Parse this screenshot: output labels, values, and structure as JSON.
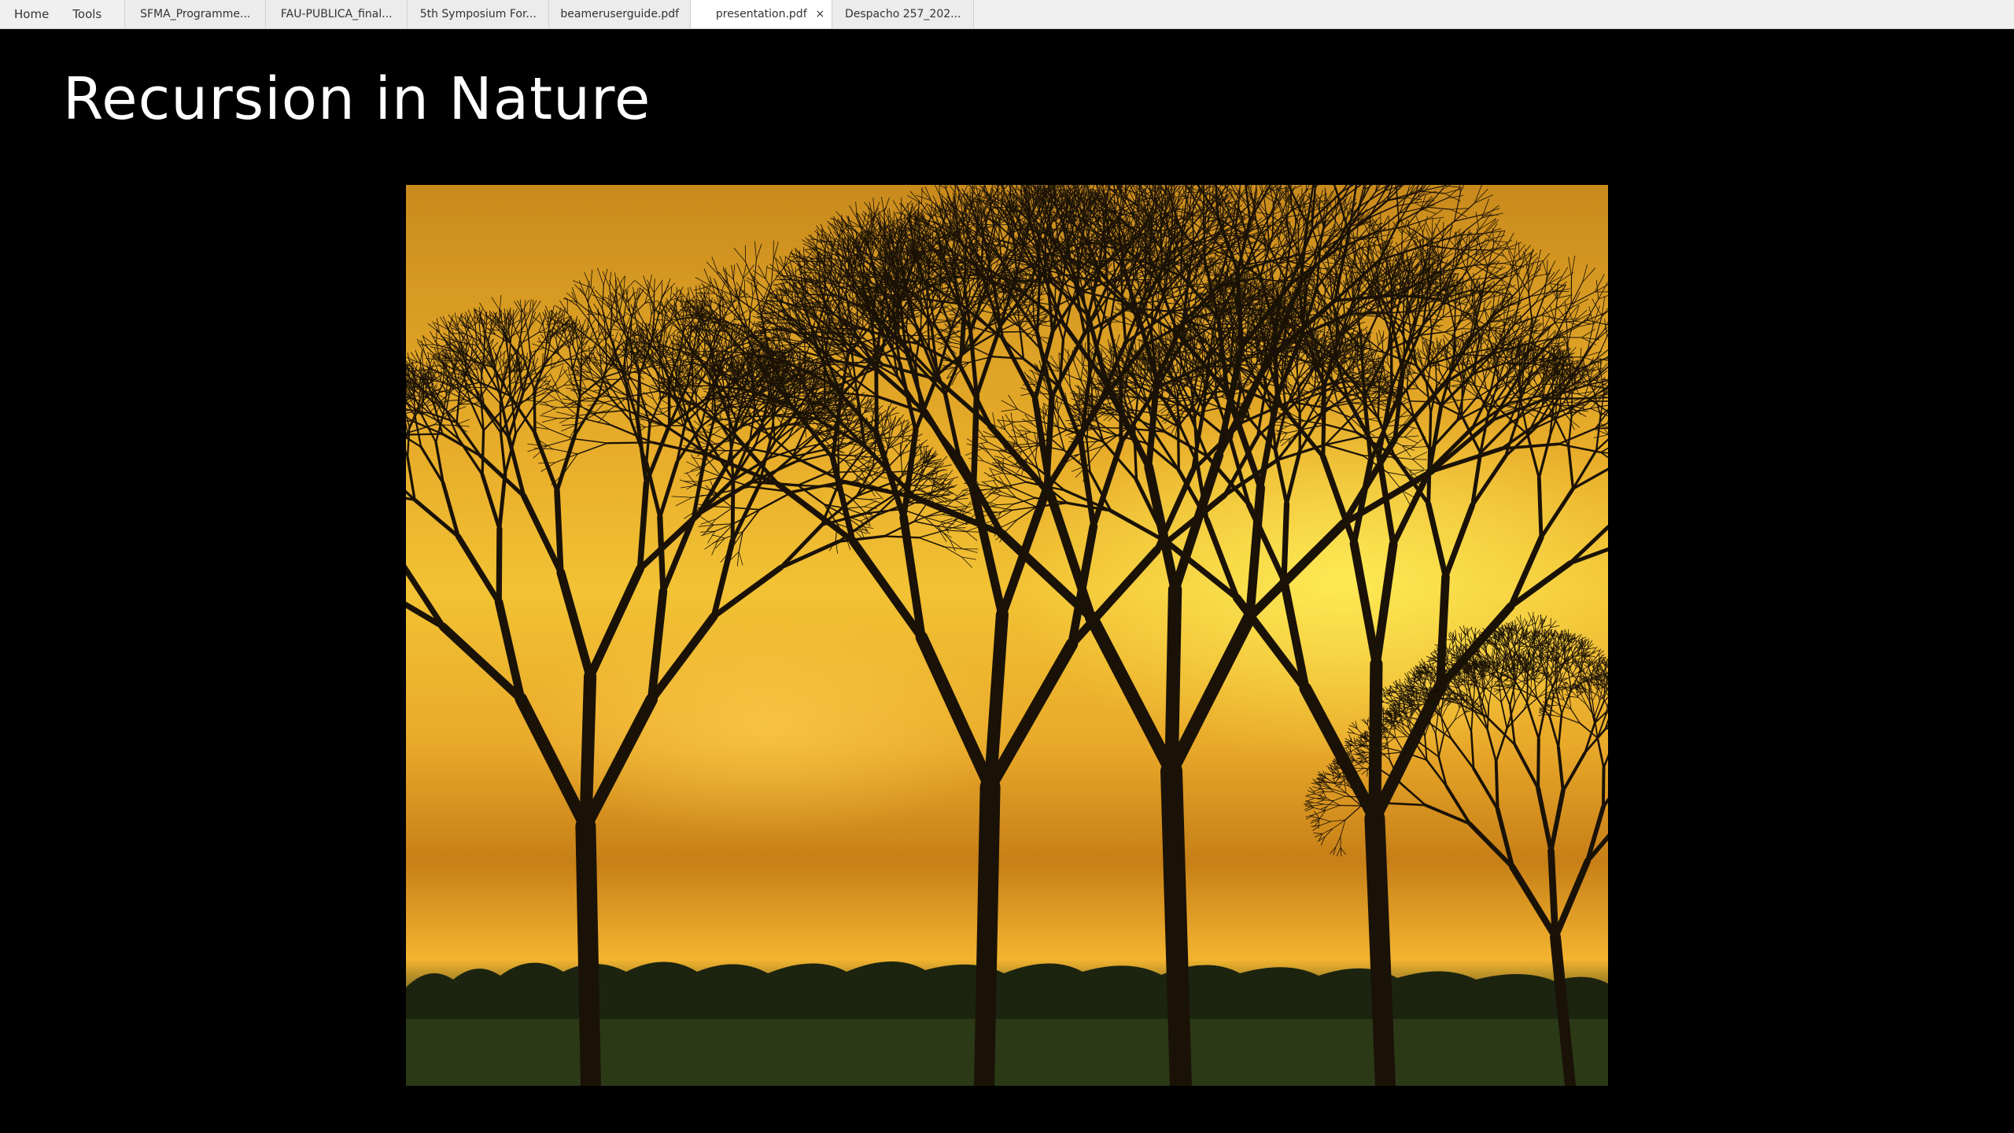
{
  "menu": {
    "home": "Home",
    "tools": "Tools"
  },
  "tabs": [
    {
      "label": "SFMA_Programme..."
    },
    {
      "label": "FAU-PUBLICA_final..."
    },
    {
      "label": "5th Symposium For..."
    },
    {
      "label": "beameruserguide.pdf"
    },
    {
      "label": "presentation.pdf",
      "active": true,
      "close_icon": "×"
    },
    {
      "label": "Despacho 257_202..."
    }
  ],
  "slide": {
    "title": "Recursion in Nature",
    "image": "silhouetted-bare-trees-at-sunset"
  },
  "colors": {
    "tabbar_bg": "#f0f0f0",
    "slide_bg": "#000000",
    "title_color": "#ffffff",
    "sky_orange": "#e8ad2a"
  }
}
